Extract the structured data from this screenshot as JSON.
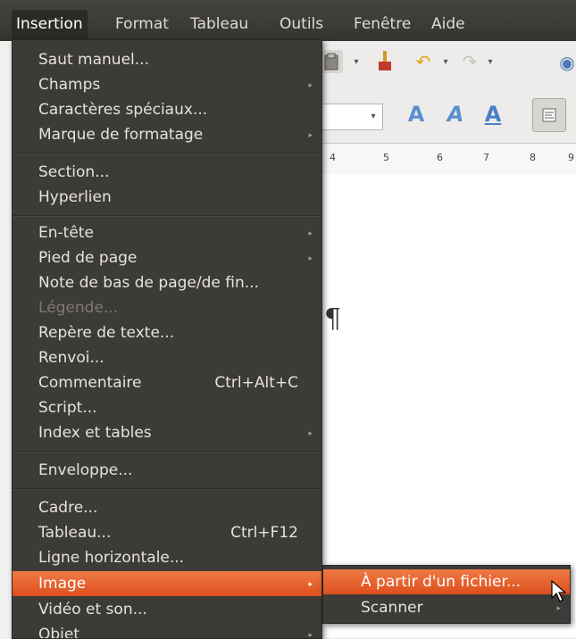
{
  "menubar": {
    "items": [
      {
        "label": "Insertion"
      },
      {
        "label": "Format"
      },
      {
        "label": "Tableau"
      },
      {
        "label": "Outils"
      },
      {
        "label": "Fenêtre"
      },
      {
        "label": "Aide"
      }
    ]
  },
  "toolbar": {
    "icons": [
      "paste-icon",
      "dropdown-arrow-icon",
      "clone-formatting-brush-icon",
      "undo-icon",
      "redo-icon",
      "navigator-icon",
      "font-dropdown-icon",
      "outline-a-icon",
      "shadow-a-icon",
      "underline-a-icon",
      "align-left-icon"
    ]
  },
  "ruler": {
    "ticks": [
      "4",
      "5",
      "6",
      "7",
      "8",
      "9"
    ]
  },
  "document": {
    "pilcrow": "¶"
  },
  "menu": {
    "items": [
      {
        "label": "Saut manuel...",
        "submenu": false
      },
      {
        "label": "Champs",
        "submenu": true
      },
      {
        "label": "Caractères spéciaux...",
        "submenu": false
      },
      {
        "label": "Marque de formatage",
        "submenu": true
      },
      {
        "label": "Section...",
        "submenu": false
      },
      {
        "label": "Hyperlien",
        "submenu": false
      },
      {
        "label": "En-tête",
        "submenu": true
      },
      {
        "label": "Pied de page",
        "submenu": true
      },
      {
        "label": "Note de bas de page/de fin...",
        "submenu": false
      },
      {
        "label": "Légende...",
        "submenu": false,
        "disabled": true
      },
      {
        "label": "Repère de texte...",
        "submenu": false
      },
      {
        "label": "Renvoi...",
        "submenu": false
      },
      {
        "label": "Commentaire",
        "accel": "Ctrl+Alt+C",
        "submenu": false
      },
      {
        "label": "Script...",
        "submenu": false
      },
      {
        "label": "Index et tables",
        "submenu": true
      },
      {
        "label": "Enveloppe...",
        "submenu": false
      },
      {
        "label": "Cadre...",
        "submenu": false
      },
      {
        "label": "Tableau...",
        "accel": "Ctrl+F12",
        "submenu": false
      },
      {
        "label": "Ligne horizontale...",
        "submenu": false
      },
      {
        "label": "Image",
        "submenu": true,
        "highlighted": true
      },
      {
        "label": "Vidéo et son...",
        "submenu": false
      },
      {
        "label": "Objet",
        "submenu": true
      }
    ]
  },
  "image_submenu": {
    "items": [
      {
        "label": "À partir d'un fichier...",
        "highlighted": true
      },
      {
        "label": "Scanner",
        "submenu": true
      }
    ]
  },
  "colors": {
    "menubar_bg": "#3c3b37",
    "highlight": "#e25a2b",
    "menu_text": "#e6e3dc",
    "disabled_text": "#7d7a73"
  }
}
